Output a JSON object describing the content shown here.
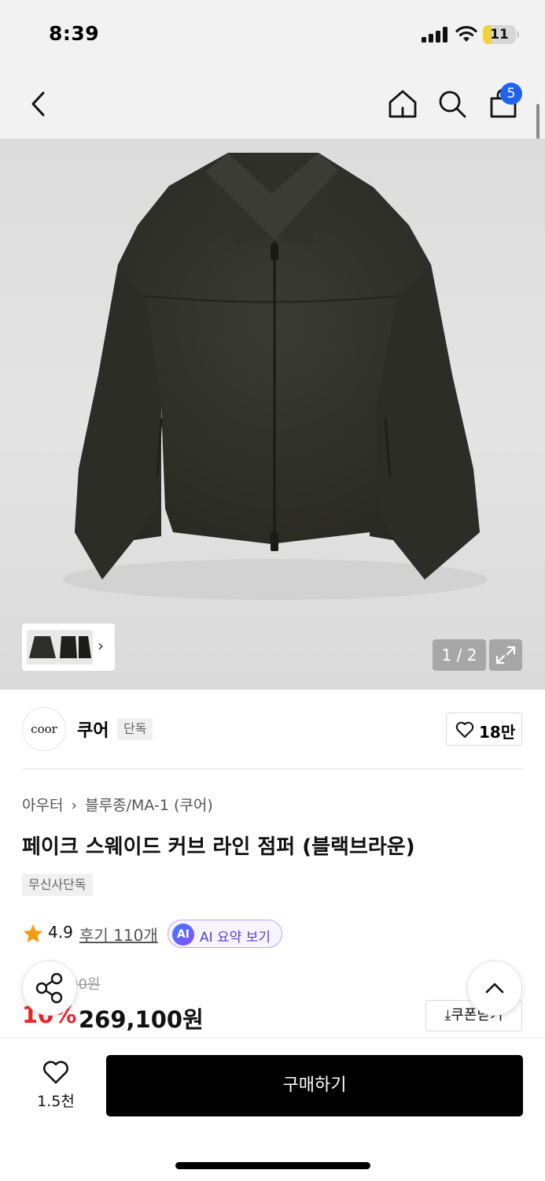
{
  "status_bar": {
    "time": "8:39",
    "battery_level": "11",
    "battery_fraction": 0.11,
    "icons": [
      "cellular-signal-icon",
      "wifi-icon",
      "battery-icon"
    ]
  },
  "nav": {
    "icons": [
      "back-chevron-icon",
      "home-icon",
      "search-icon",
      "shopping-bag-icon"
    ],
    "cart_count": "5"
  },
  "gallery": {
    "page_indicator": "1 / 2",
    "thumbnail_chevron": "›",
    "product_color": "#34352f",
    "icons": [
      "expand-icon"
    ]
  },
  "brand": {
    "logo_text": "coor",
    "name": "쿠어",
    "tag": "단독",
    "like_count": "18만"
  },
  "product": {
    "breadcrumb": [
      "아우터",
      "›",
      "블루종/MA-1 (쿠어)"
    ],
    "title": "페이크 스웨이드 커브 라인 점퍼 (블랙브라운)",
    "exclusive_tag": "무신사단독",
    "rating": "4.9",
    "review_label": "후기 110개",
    "ai_badge": "AI",
    "ai_label": "AI 요약 보기"
  },
  "price": {
    "original_partial": "00원",
    "discount_partial": "10%",
    "sale_price": "269,100원",
    "coupon_label": "⤓쿠폰받기"
  },
  "bottom": {
    "wish_count": "1.5천",
    "buy_label": "구매하기"
  },
  "colors": {
    "accent_blue": "#1e63f0",
    "discount_red": "#e8262c",
    "ai_purple": "#5b3fd6",
    "star_orange": "#f39c12",
    "battery_yellow": "#f2d23b"
  }
}
